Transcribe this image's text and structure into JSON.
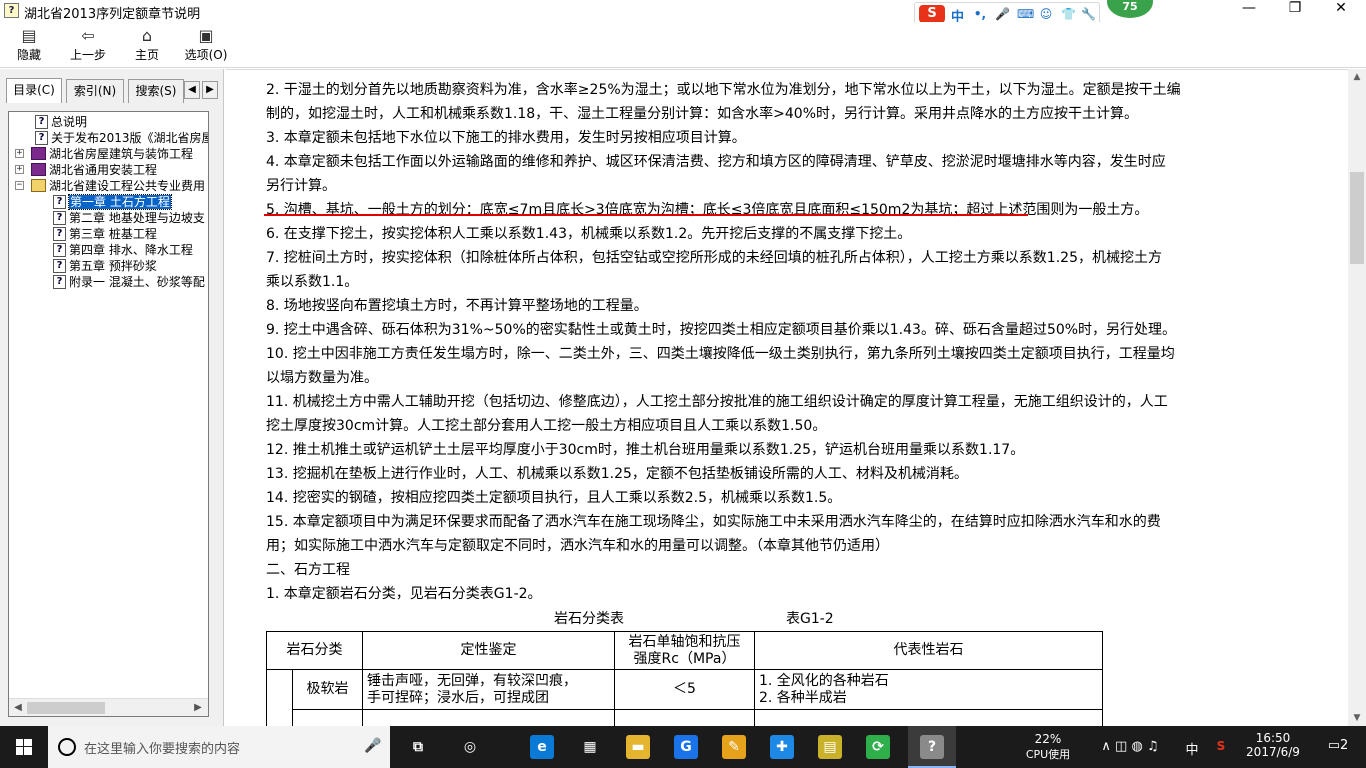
{
  "window": {
    "app_icon": "help-file-icon",
    "title": "湖北省2013序列定额章节说明",
    "minimize_glyph": "—",
    "maximize_glyph": "❐",
    "close_glyph": "✕"
  },
  "ime_bar": {
    "logo": "S",
    "lang": "中",
    "icons": [
      "punctuation-icon",
      "microphone-icon",
      "keyboard-icon",
      "user-icon",
      "skin-icon",
      "settings-icon"
    ],
    "glyphs": [
      "•,",
      "🎤",
      "⌨",
      "☺",
      "👕",
      "🔧"
    ],
    "badge": "75"
  },
  "toolbar": {
    "items": [
      {
        "name": "hide",
        "label": "隐藏",
        "icon": "hide-pane-icon",
        "glyph": "▤"
      },
      {
        "name": "back",
        "label": "上一步",
        "icon": "back-arrow-icon",
        "glyph": "⇦"
      },
      {
        "name": "home",
        "label": "主页",
        "icon": "home-icon",
        "glyph": "⌂"
      },
      {
        "name": "options",
        "label": "选项(O)",
        "icon": "options-icon",
        "glyph": "▣"
      }
    ]
  },
  "nav": {
    "tabs": [
      {
        "label": "目录(C)",
        "active": true
      },
      {
        "label": "索引(N)",
        "active": false
      },
      {
        "label": "搜索(S)",
        "active": false
      }
    ],
    "arrow_left": "◀",
    "arrow_right": "▶",
    "tree": [
      {
        "label": "总说明",
        "icon": "help-topic-icon",
        "level": 1,
        "expander": "",
        "selected": false
      },
      {
        "label": "关于发布2013版《湖北省房屋",
        "icon": "help-topic-icon",
        "level": 1,
        "expander": "",
        "selected": false
      },
      {
        "label": "湖北省房屋建筑与装饰工程",
        "icon": "closed-book-icon",
        "level": 0,
        "expander": "+",
        "selected": false
      },
      {
        "label": "湖北省通用安装工程",
        "icon": "closed-book-icon",
        "level": 0,
        "expander": "+",
        "selected": false
      },
      {
        "label": "湖北省建设工程公共专业费用",
        "icon": "open-book-icon",
        "level": 0,
        "expander": "−",
        "selected": false
      },
      {
        "label": "第一章 土石方工程",
        "icon": "help-topic-icon",
        "level": 2,
        "expander": "",
        "selected": true
      },
      {
        "label": "第二章 地基处理与边坡支",
        "icon": "help-topic-icon",
        "level": 2,
        "expander": "",
        "selected": false
      },
      {
        "label": "第三章 桩基工程",
        "icon": "help-topic-icon",
        "level": 2,
        "expander": "",
        "selected": false
      },
      {
        "label": "第四章 排水、降水工程",
        "icon": "help-topic-icon",
        "level": 2,
        "expander": "",
        "selected": false
      },
      {
        "label": "第五章 预拌砂浆",
        "icon": "help-topic-icon",
        "level": 2,
        "expander": "",
        "selected": false
      },
      {
        "label": "附录一 混凝土、砂浆等配",
        "icon": "help-topic-icon",
        "level": 2,
        "expander": "",
        "selected": false
      }
    ]
  },
  "content": {
    "lines": [
      "2. 干湿土的划分首先以地质勘察资料为准，含水率≥25%为湿土；或以地下常水位为准划分，地下常水位以上为干土，以下为湿土。定额是按干土编",
      "制的，如挖湿土时，人工和机械乘系数1.18，干、湿土工程量分别计算：如含水率>40%时，另行计算。采用井点降水的土方应按干土计算。",
      "3. 本章定额未包括地下水位以下施工的排水费用，发生时另按相应项目计算。",
      "4. 本章定额未包括工作面以外运输路面的维修和养护、城区环保清洁费、挖方和填方区的障碍清理、铲草皮、挖淤泥时堰塘排水等内容，发生时应",
      "另行计算。",
      "5. 沟槽、基坑、一般土方的划分：底宽≤7m且底长>3倍底宽为沟槽；底长≤3倍底宽且底面积≤150m2为基坑；超过上述范围则为一般土方。",
      "6. 在支撑下挖土，按实挖体积人工乘以系数1.43，机械乘以系数1.2。先开挖后支撑的不属支撑下挖土。",
      "7. 挖桩间土方时，按实挖体积（扣除桩体所占体积，包括空钻或空挖所形成的未经回填的桩孔所占体积），人工挖土方乘以系数1.25，机械挖土方",
      "乘以系数1.1。",
      "8. 场地按竖向布置挖填土方时，不再计算平整场地的工程量。",
      "9. 挖土中遇含碎、砾石体积为31%~50%的密实黏性土或黄土时，按挖四类土相应定额项目基价乘以1.43。碎、砾石含量超过50%时，另行处理。",
      "10. 挖土中因非施工方责任发生塌方时，除一、二类土外，三、四类土壤按降低一级土类别执行，第九条所列土壤按四类土定额项目执行，工程量均",
      "以塌方数量为准。",
      "11. 机械挖土方中需人工辅助开挖（包括切边、修整底边），人工挖土部分按批准的施工组织设计确定的厚度计算工程量，无施工组织设计的，人工",
      "挖土厚度按30cm计算。人工挖土部分套用人工挖一般土方相应项目且人工乘以系数1.50。",
      "12. 推土机推土或铲运机铲土土层平均厚度小于30cm时，推土机台班用量乘以系数1.25，铲运机台班用量乘以系数1.17。",
      "13. 挖掘机在垫板上进行作业时，人工、机械乘以系数1.25，定额不包括垫板铺设所需的人工、材料及机械消耗。",
      "14. 挖密实的钢碴，按相应挖四类土定额项目执行，且人工乘以系数2.5，机械乘以系数1.5。",
      "15. 本章定额项目中为满足环保要求而配备了洒水汽车在施工现场降尘，如实际施工中未采用洒水汽车降尘的，在结算时应扣除洒水汽车和水的费",
      "用；如实际施工中洒水汽车与定额取定不同时，洒水汽车和水的用量可以调整。（本章其他节仍适用）",
      "二、石方工程",
      "1. 本章定额岩石分类，见岩石分类表G1-2。"
    ],
    "underline_color": "#e00000",
    "table_title": "岩石分类表",
    "table_id": "表G1-2",
    "table_headers": [
      "岩石分类",
      "定性鉴定",
      "岩石单轴饱和抗压",
      "强度Rc（MPa）",
      "代表性岩石"
    ],
    "table_rows": [
      {
        "category": "极软岩",
        "qualitative": [
          "锤击声哑，无回弹，有较深凹痕，",
          "手可捏碎；浸水后，可捏成团"
        ],
        "strength": "＜5",
        "examples": [
          "1. 全风化的各种岩石",
          "2. 各种半成岩"
        ]
      }
    ]
  },
  "scrollbars": {
    "up": "▲",
    "down": "▼",
    "left": "◀",
    "right": "▶"
  },
  "taskbar": {
    "search_placeholder": "在这里输入你要搜索的内容",
    "mic_glyph": "🎤",
    "apps": [
      {
        "name": "task-view",
        "glyph": "⧉",
        "color": "#1b1b1b"
      },
      {
        "name": "360-browser",
        "glyph": "◎",
        "color": "#1b1b1b"
      },
      {
        "name": "edge",
        "glyph": "e",
        "color": "#0a7ad6"
      },
      {
        "name": "store",
        "glyph": "▦",
        "color": "#1b1b1b"
      },
      {
        "name": "file-explorer",
        "glyph": "▬",
        "color": "#e6b530"
      },
      {
        "name": "google-app",
        "glyph": "G",
        "color": "#1a73e8"
      },
      {
        "name": "notes-app",
        "glyph": "✎",
        "color": "#e7a21c"
      },
      {
        "name": "add-app",
        "glyph": "✚",
        "color": "#1e88e5"
      },
      {
        "name": "calendar-app",
        "glyph": "▤",
        "color": "#c9b12a"
      },
      {
        "name": "refresh-app",
        "glyph": "⟳",
        "color": "#2eaf4a"
      },
      {
        "name": "help-viewer",
        "glyph": "?",
        "color": "#8a8a8a",
        "active": true
      }
    ],
    "cpu_percent": "22%",
    "cpu_label": "CPU使用",
    "tray_glyphs": "∧ ◫ ◍ ♫",
    "ime": "中",
    "time": "16:50",
    "date": "2017/6/9",
    "notifications": "2"
  }
}
